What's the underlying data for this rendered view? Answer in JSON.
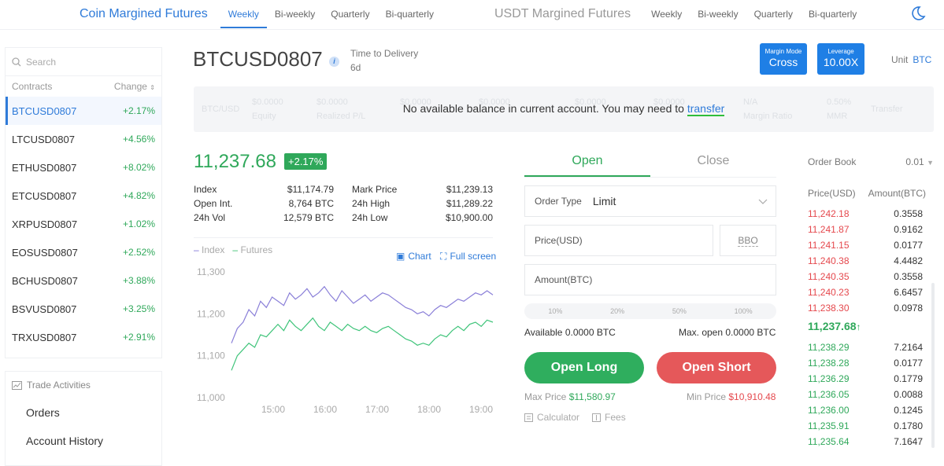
{
  "nav": {
    "coin_group": "Coin Margined Futures",
    "coin_periods": [
      "Weekly",
      "Bi-weekly",
      "Quarterly",
      "Bi-quarterly"
    ],
    "usdt_group": "USDT Margined Futures",
    "usdt_periods": [
      "Weekly",
      "Bi-weekly",
      "Quarterly",
      "Bi-quarterly"
    ],
    "theme_icon": "moon-icon"
  },
  "sidebar": {
    "search_placeholder": "Search",
    "col_contracts": "Contracts",
    "col_change": "Change",
    "contracts": [
      {
        "name": "BTCUSD0807",
        "change": "+2.17%"
      },
      {
        "name": "LTCUSD0807",
        "change": "+4.56%"
      },
      {
        "name": "ETHUSD0807",
        "change": "+8.02%"
      },
      {
        "name": "ETCUSD0807",
        "change": "+4.82%"
      },
      {
        "name": "XRPUSD0807",
        "change": "+1.02%"
      },
      {
        "name": "EOSUSD0807",
        "change": "+2.52%"
      },
      {
        "name": "BCHUSD0807",
        "change": "+3.88%"
      },
      {
        "name": "BSVUSD0807",
        "change": "+3.25%"
      },
      {
        "name": "TRXUSD0807",
        "change": "+2.91%"
      }
    ],
    "activities_title": "Trade Activities",
    "activities": [
      "Orders",
      "Account History"
    ]
  },
  "header": {
    "symbol": "BTCUSD0807",
    "info_glyph": "i",
    "time_label": "Time to Delivery",
    "time_value": "6d",
    "margin_mode_label": "Margin Mode",
    "margin_mode_value": "Cross",
    "leverage_label": "Leverage",
    "leverage_value": "10.00X",
    "unit_label": "Unit",
    "unit_value": "BTC"
  },
  "balance": {
    "message": "No available balance in current account. You may need to",
    "link": "transfer",
    "ghost": [
      "BTC/USD",
      "$0.0000",
      "Equity",
      "$0.0000",
      "Realized P/L",
      "$0.0000",
      "$0.0000",
      "$0.0000",
      "$0.0000",
      "N/A",
      "Margin Ratio",
      "0.50%",
      "MMR",
      "Transfer"
    ]
  },
  "ticker": {
    "price": "11,237.68",
    "change": "+2.17%",
    "stats_left": [
      {
        "label": "Index",
        "value": "$11,174.79"
      },
      {
        "label": "Open Int.",
        "value": "8,764 BTC"
      },
      {
        "label": "24h Vol",
        "value": "12,579 BTC"
      }
    ],
    "stats_right": [
      {
        "label": "Mark Price",
        "value": "$11,239.13"
      },
      {
        "label": "24h High",
        "value": "$11,289.22"
      },
      {
        "label": "24h Low",
        "value": "$10,900.00"
      }
    ]
  },
  "chart_ui": {
    "legend_index": "Index",
    "legend_futures": "Futures",
    "chart_link": "Chart",
    "fullscreen_link": "Full screen"
  },
  "chart_data": {
    "type": "line",
    "x_ticks": [
      "15:00",
      "16:00",
      "17:00",
      "18:00",
      "19:00"
    ],
    "y_ticks": [
      "11,300",
      "11,200",
      "11,100",
      "11,000"
    ],
    "ylim": [
      11000,
      11300
    ],
    "series": [
      {
        "name": "Index",
        "color": "#8a7fd8",
        "values": [
          11130,
          11165,
          11180,
          11210,
          11195,
          11230,
          11215,
          11240,
          11230,
          11220,
          11250,
          11235,
          11245,
          11260,
          11240,
          11250,
          11265,
          11245,
          11230,
          11255,
          11240,
          11225,
          11235,
          11245,
          11230,
          11240,
          11250,
          11245,
          11235,
          11225,
          11215,
          11210,
          11200,
          11205,
          11195,
          11210,
          11220,
          11215,
          11225,
          11235,
          11230,
          11240,
          11250,
          11245,
          11255,
          11245
        ]
      },
      {
        "name": "Futures",
        "color": "#3fc47a",
        "values": [
          11065,
          11100,
          11115,
          11130,
          11120,
          11150,
          11145,
          11160,
          11175,
          11160,
          11185,
          11170,
          11160,
          11175,
          11190,
          11170,
          11160,
          11180,
          11170,
          11160,
          11175,
          11165,
          11160,
          11170,
          11160,
          11155,
          11165,
          11170,
          11160,
          11150,
          11140,
          11135,
          11125,
          11130,
          11125,
          11140,
          11150,
          11145,
          11160,
          11170,
          11160,
          11175,
          11180,
          11170,
          11185,
          11180
        ]
      }
    ]
  },
  "order": {
    "tab_open": "Open",
    "tab_close": "Close",
    "order_type_label": "Order Type",
    "order_type_value": "Limit",
    "price_label": "Price(USD)",
    "bbo_label": "BBO",
    "amount_label": "Amount(BTC)",
    "percents": [
      "10%",
      "20%",
      "50%",
      "100%"
    ],
    "available": "Available 0.0000 BTC",
    "max_open": "Max. open 0.0000 BTC",
    "long_button": "Open Long",
    "short_button": "Open Short",
    "max_price_label": "Max Price",
    "max_price_value": "$11,580.97",
    "min_price_label": "Min Price",
    "min_price_value": "$10,910.48",
    "calculator_label": "Calculator",
    "fees_label": "Fees"
  },
  "orderbook": {
    "title": "Order Book",
    "precision": "0.01",
    "col_price": "Price(USD)",
    "col_amount": "Amount(BTC)",
    "asks": [
      {
        "price": "11,242.18",
        "amount": "0.3558"
      },
      {
        "price": "11,241.87",
        "amount": "0.9162"
      },
      {
        "price": "11,241.15",
        "amount": "0.0177"
      },
      {
        "price": "11,240.38",
        "amount": "4.4482"
      },
      {
        "price": "11,240.35",
        "amount": "0.3558"
      },
      {
        "price": "11,240.23",
        "amount": "6.6457"
      },
      {
        "price": "11,238.30",
        "amount": "0.0978"
      }
    ],
    "last_price": "11,237.68",
    "last_arrow": "↑",
    "bids": [
      {
        "price": "11,238.29",
        "amount": "7.2164"
      },
      {
        "price": "11,238.28",
        "amount": "0.0177"
      },
      {
        "price": "11,236.29",
        "amount": "0.1779"
      },
      {
        "price": "11,236.05",
        "amount": "0.0088"
      },
      {
        "price": "11,236.00",
        "amount": "0.1245"
      },
      {
        "price": "11,235.91",
        "amount": "0.1780"
      },
      {
        "price": "11,235.64",
        "amount": "7.1647"
      }
    ]
  }
}
